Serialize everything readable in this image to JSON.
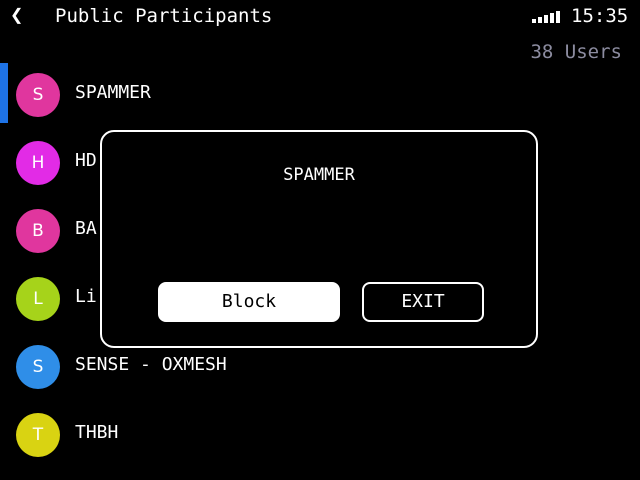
{
  "header": {
    "back_icon": "chevron-left-icon",
    "title": "Public Participants",
    "signal_icon": "signal-bars-icon",
    "time": "15:35"
  },
  "user_count": "38 Users",
  "participants": [
    {
      "initial": "S",
      "name": "SPAMMER",
      "color": "#e0369e",
      "selected": true
    },
    {
      "initial": "H",
      "name": "HD",
      "color": "#e22be6",
      "selected": false
    },
    {
      "initial": "B",
      "name": "BA",
      "color": "#e0369e",
      "selected": false
    },
    {
      "initial": "L",
      "name": "Li",
      "color": "#a6d31a",
      "selected": false
    },
    {
      "initial": "S",
      "name": "SENSE - OXMESH",
      "color": "#2f8ee8",
      "selected": false
    },
    {
      "initial": "T",
      "name": "THBH",
      "color": "#d9d312",
      "selected": false
    }
  ],
  "dialog": {
    "title": "SPAMMER",
    "block_label": "Block",
    "exit_label": "EXIT"
  },
  "colors": {
    "accent": "#1e73e6",
    "muted_text": "#8c8ca0"
  }
}
